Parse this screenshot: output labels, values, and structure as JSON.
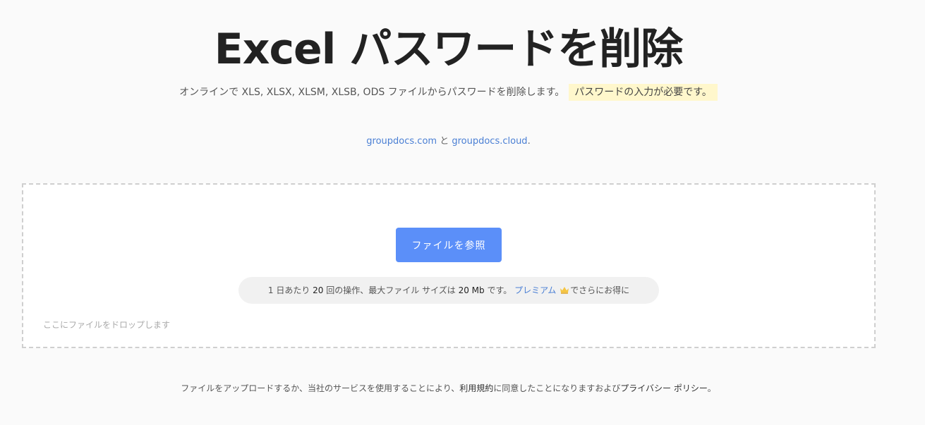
{
  "header": {
    "title": "Excel パスワードを削除",
    "subtitle": "オンラインで XLS, XLSX, XLSM, XLSB, ODS ファイルからパスワードを削除します。",
    "subtitle_highlight": "パスワードの入力が必要です。"
  },
  "credits": {
    "link1": "groupdocs.com",
    "separator": " と ",
    "link2": "groupdocs.cloud",
    "suffix": "."
  },
  "dropzone": {
    "browse_button": "ファイルを参照",
    "limit_prefix": "1 日あたり",
    "limit_ops_count": "20",
    "limit_ops_text": "回の操作、最大ファイル サイズは",
    "limit_size": "20 Mb",
    "limit_size_suffix": "です。",
    "premium_link": "プレミアム",
    "premium_suffix": "でさらにお得に",
    "drop_hint": "ここにファイルをドロップします"
  },
  "footer": {
    "terms_prefix": "ファイルをアップロードするか、当社のサービスを使用することにより、",
    "terms_link": "利用規約",
    "terms_middle": "に同意したことになりますおよび",
    "privacy_link": "プライバシー ポリシー",
    "terms_suffix": "。"
  },
  "colors": {
    "accent": "#5b8ff9",
    "link": "#4a7fd4",
    "highlight": "#fff7cc"
  },
  "icons": {
    "premium": "crown-icon"
  }
}
